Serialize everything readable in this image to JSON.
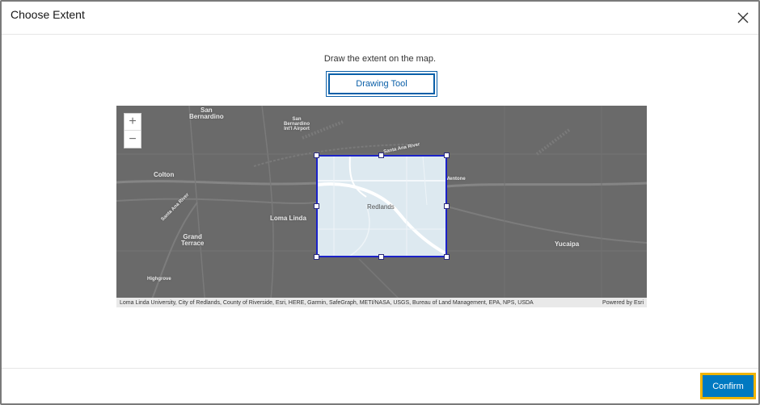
{
  "dialog": {
    "title": "Choose Extent",
    "close_icon": "close-icon"
  },
  "content": {
    "instruction": "Draw the extent on the map.",
    "drawing_tool_label": "Drawing Tool"
  },
  "map": {
    "zoom_in": "+",
    "zoom_out": "−",
    "labels": {
      "san_bernardino": "San\nBernardino",
      "airport": "San\nBernardino\nInt'l Airport",
      "santa_ana_river_top": "Santa Ana River",
      "colton": "Colton",
      "santa_ana_river_left": "Santa Ana River",
      "loma_linda": "Loma Linda",
      "grand_terrace": "Grand\nTerrace",
      "highgrove": "Highgrove",
      "mentone": "Mentone",
      "yucaipa": "Yucaipa",
      "redlands": "Redlands"
    },
    "attribution": "Loma Linda University, City of Redlands, County of Riverside, Esri, HERE, Garmin, SafeGraph, METI/NASA, USGS, Bureau of Land Management, EPA, NPS, USDA",
    "powered_by": "Powered by Esri"
  },
  "footer": {
    "confirm_label": "Confirm"
  },
  "colors": {
    "accent": "#0079c1",
    "focus_ring": "#f0b400",
    "extent_border": "#1b22c8"
  }
}
